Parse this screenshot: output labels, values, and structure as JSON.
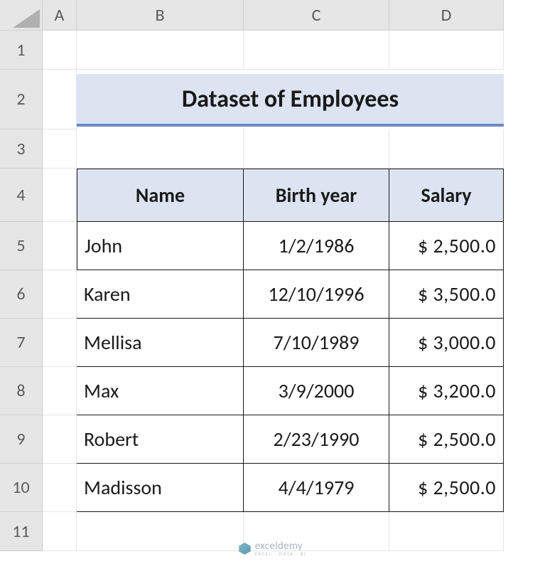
{
  "columns": [
    "A",
    "B",
    "C",
    "D"
  ],
  "rows": [
    "1",
    "2",
    "3",
    "4",
    "5",
    "6",
    "7",
    "8",
    "9",
    "10",
    "11"
  ],
  "title": "Dataset of Employees",
  "table": {
    "headers": [
      "Name",
      "Birth year",
      "Salary"
    ],
    "data": [
      {
        "name": "John",
        "birth": "1/2/1986",
        "salary": "$ 2,500.0"
      },
      {
        "name": "Karen",
        "birth": "12/10/1996",
        "salary": "$ 3,500.0"
      },
      {
        "name": "Mellisa",
        "birth": "7/10/1989",
        "salary": "$ 3,000.0"
      },
      {
        "name": "Max",
        "birth": "3/9/2000",
        "salary": "$ 3,200.0"
      },
      {
        "name": "Robert",
        "birth": "2/23/1990",
        "salary": "$ 2,500.0"
      },
      {
        "name": "Madisson",
        "birth": "4/4/1979",
        "salary": "$ 2,500.0"
      }
    ]
  },
  "watermark": {
    "brand": "exceldemy",
    "tagline": "EXCEL · DATA · BI"
  }
}
